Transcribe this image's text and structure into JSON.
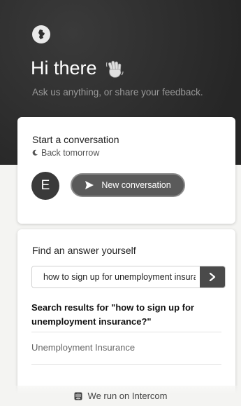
{
  "header": {
    "greeting": "Hi there",
    "subtitle": "Ask us anything, or share your feedback.",
    "background_color": "#2f2f2f"
  },
  "conversation_card": {
    "title": "Start a conversation",
    "status": "Back tomorrow",
    "avatar_initial": "E",
    "new_conversation_label": "New conversation"
  },
  "search_card": {
    "title": "Find an answer yourself",
    "search_value": "how to sign up for unemployment insurance?",
    "results_heading": "Search results for \"how to sign up for unemployment insurance?\"",
    "results": [
      "Unemployment Insurance"
    ]
  },
  "footer": {
    "label": "We run on Intercom"
  }
}
